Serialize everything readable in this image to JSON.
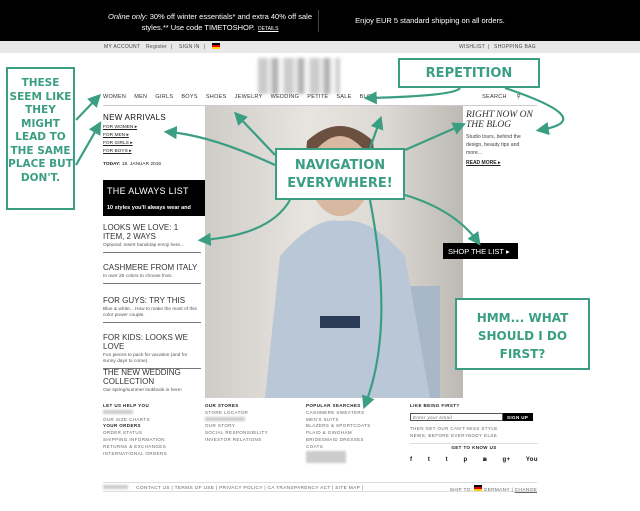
{
  "promo": {
    "left_italic": "Online only:",
    "left_text": "30% off winter essentials* and extra 40% off sale styles.** Use code TIMETOSHOP.",
    "details": "DETAILS",
    "right": "Enjoy EUR 5 standard shipping on all orders."
  },
  "account": {
    "my_account": "MY ACCOUNT",
    "register": "Register",
    "sign_in": "SIGN IN",
    "wishlist": "WISHLIST",
    "shopping_bag": "SHOPPING BAG",
    "sep": "|"
  },
  "nav": {
    "items": [
      "WOMEN",
      "MEN",
      "GIRLS",
      "BOYS",
      "SHOES",
      "JEWELRY",
      "WEDDING",
      "PETITE",
      "SALE",
      "BLOG"
    ],
    "search": "SEARCH"
  },
  "left": {
    "new_arrivals": "NEW ARRIVALS",
    "links": [
      "FOR WOMEN",
      "FOR MEN",
      "FOR GIRLS",
      "FOR BOYS"
    ],
    "today_label": "TODAY:",
    "today_date": "18. JANUAR 2016",
    "always_title": "THE ALWAYS LIST",
    "always_sub": "10 styles you'll always wear and love.",
    "stories": [
      {
        "title": "LOOKS WE LOVE: 1 ITEM, 2 WAYS",
        "desc": "Optional: Insert handclap emoji here..."
      },
      {
        "title": "CASHMERE FROM ITALY",
        "desc": "In over 25 colors to choose from."
      },
      {
        "title": "FOR GUYS: TRY THIS",
        "desc": "Blue & white... How to make the most of this color power couple."
      },
      {
        "title": "FOR KIDS: LOOKS WE LOVE",
        "desc": "Fun pieces to pack for vacation (and for sunny days to come)."
      },
      {
        "title": "THE NEW WEDDING COLLECTION",
        "desc": "Our spring/summer lookbook is here!"
      }
    ]
  },
  "right": {
    "title": "RIGHT NOW ON THE BLOG",
    "desc": "Studio tours, behind the design, beauty tips and more...",
    "read_more": "READ MORE"
  },
  "hero": {
    "shop_button": "SHOP THE LIST"
  },
  "footer": {
    "help": {
      "title": "LET US HELP YOU",
      "items": [
        "OUR SIZE CHARTS"
      ],
      "orders_title": "YOUR ORDERS",
      "orders": [
        "ORDER STATUS",
        "SHIPPING INFORMATION",
        "RETURNS & EXCHANGES",
        "INTERNATIONAL ORDERS"
      ]
    },
    "stores": {
      "title": "OUR STORES",
      "items": [
        "STORE LOCATOR"
      ],
      "more": [
        "OUR STORY",
        "SOCIAL RESPONSIBILITY",
        "INVESTOR RELATIONS"
      ]
    },
    "searches": {
      "title": "POPULAR SEARCHES",
      "items": [
        "CASHMERE SWEATERS",
        "MEN'S SUITS",
        "BLAZERS & SPORTCOATS",
        "PLAID & GINGHAM",
        "BRIDESMAID DRESSES",
        "COATS"
      ]
    },
    "newsletter": {
      "title": "LIKE BEING FIRST?",
      "placeholder": "Enter your email",
      "signup": "SIGN UP",
      "text": "THEN GET OUR CAN'T-MISS STYLE NEWS, BEFORE EVERYBODY ELSE.",
      "get_to_know": "GET TO KNOW US",
      "social": [
        "f",
        "t",
        "t",
        "p",
        "◙",
        "g+",
        "You"
      ]
    },
    "bottom": {
      "links": [
        "CONTACT US",
        "TERMS OF USE",
        "PRIVACY POLICY",
        "CA TRANSPARENCY ACT",
        "SITE MAP"
      ],
      "ship_to": "SHIP TO:",
      "country": "GERMANY",
      "change": "CHANGE"
    }
  },
  "annotations": {
    "same_place": "THESE SEEM LIKE THEY MIGHT LEAD TO THE SAME PLACE BUT DON'T.",
    "repetition": "REPETITION",
    "navigation": "NAVIGATION EVERYWHERE!",
    "hmm": "HMM... WHAT SHOULD I DO FIRST?"
  },
  "colors": {
    "annotation": "#3a9e82",
    "promo_bg": "#000000"
  }
}
